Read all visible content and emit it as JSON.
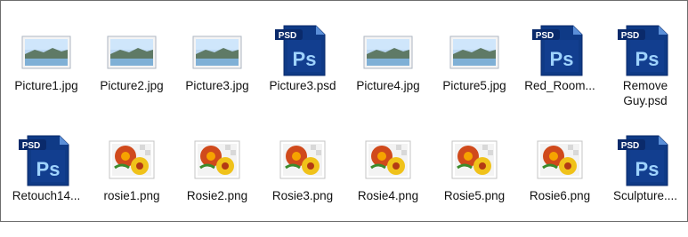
{
  "files": [
    {
      "name": "Picture1.jpg",
      "icon": "landscape-image-icon"
    },
    {
      "name": "Picture2.jpg",
      "icon": "landscape-image-icon"
    },
    {
      "name": "Picture3.jpg",
      "icon": "landscape-image-icon"
    },
    {
      "name": "Picture3.psd",
      "icon": "psd-file-icon"
    },
    {
      "name": "Picture4.jpg",
      "icon": "landscape-image-icon"
    },
    {
      "name": "Picture5.jpg",
      "icon": "landscape-image-icon"
    },
    {
      "name": "Red_Room...",
      "icon": "psd-file-icon"
    },
    {
      "name": "Remove\nGuy.psd",
      "icon": "psd-file-icon"
    },
    {
      "name": "Retouch14...",
      "icon": "psd-file-icon"
    },
    {
      "name": "rosie1.png",
      "icon": "flower-image-icon"
    },
    {
      "name": "Rosie2.png",
      "icon": "flower-image-icon"
    },
    {
      "name": "Rosie3.png",
      "icon": "flower-image-icon"
    },
    {
      "name": "Rosie4.png",
      "icon": "flower-image-icon"
    },
    {
      "name": "Rosie5.png",
      "icon": "flower-image-icon"
    },
    {
      "name": "Rosie6.png",
      "icon": "flower-image-icon"
    },
    {
      "name": "Sculpture....",
      "icon": "psd-file-icon"
    }
  ],
  "psd_badge_text": "PSD",
  "ps_logo_text": "Ps",
  "colors": {
    "psd_blue_dark": "#0a2a6b",
    "psd_blue": "#1b5fb8",
    "ps_text": "#9fd3ff"
  }
}
